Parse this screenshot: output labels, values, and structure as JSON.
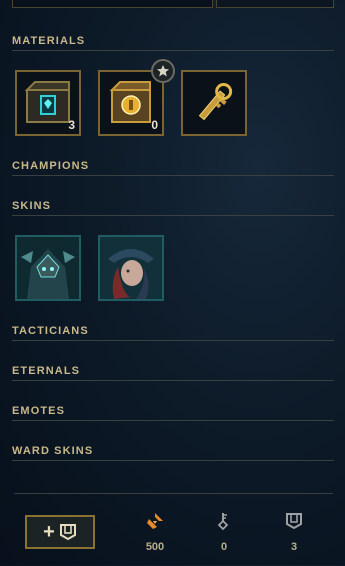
{
  "sections": {
    "materials": "MATERIALS",
    "champions": "CHAMPIONS",
    "skins": "SKINS",
    "tacticians": "TACTICIANS",
    "eternals": "ETERNALS",
    "emotes": "EMOTES",
    "ward_skins": "WARD SKINS"
  },
  "materials": [
    {
      "name": "hextech-chest",
      "count": "3"
    },
    {
      "name": "masterwork-chest",
      "count": "0"
    },
    {
      "name": "hextech-key",
      "count": ""
    }
  ],
  "skins": [
    {
      "name": "skin-armored-warrior"
    },
    {
      "name": "skin-cannoneer"
    }
  ],
  "footer": {
    "orange_essence": "500",
    "keys": "0",
    "chests": "3"
  },
  "colors": {
    "gold": "#c8b88a",
    "tile_border_gold": "#7a6432",
    "tile_border_teal": "#1f5d63",
    "orange_essence": "#e8892a"
  }
}
